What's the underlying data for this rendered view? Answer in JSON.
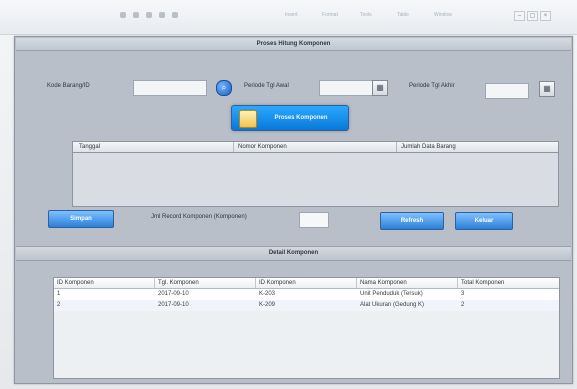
{
  "toolbar": {
    "items": [
      "Insert",
      "Format",
      "Tools",
      "Table",
      "Window"
    ],
    "win_controls": [
      "–",
      "▢",
      "×"
    ]
  },
  "window": {
    "title": "Proses Hitung Komponen",
    "filters": {
      "kode_label": "Kode Barang/ID",
      "kode_value": "",
      "from_label": "Periode Tgl Awal",
      "from_value": "",
      "to_label": "Periode Tgl Akhir",
      "to_value": ""
    },
    "process_button_label": "Proses Komponen",
    "table1": {
      "columns": [
        "Tanggal",
        "Nomor Komponen",
        "Jumlah Data Barang"
      ],
      "rows": []
    },
    "bottom_controls": {
      "left_button_label": "Simpan",
      "info_label": "Jml Record Komponen (Komponen)",
      "info_value": "",
      "right_button1_label": "Refresh",
      "right_button2_label": "Keluar"
    },
    "section2_title": "Detail Komponen",
    "table2": {
      "columns": [
        "ID Komponen",
        "Tgl. Komponen",
        "ID Komponen",
        "Nama Komponen",
        "Total Komponen"
      ],
      "rows": [
        [
          "1",
          "2017-09-10",
          "K-203",
          "Unit Penduduk (Tersuk)",
          "3"
        ],
        [
          "2",
          "2017-09-10",
          "K-209",
          "Alat Ukuran (Gedung K)",
          "2"
        ]
      ]
    }
  },
  "colors": {
    "accent_blue": "#2c7fd7",
    "window_bg": "#b9bfc8",
    "title_bar": "#bfc6cf"
  },
  "icons": {
    "search": "search-icon",
    "calendar": "calendar-icon",
    "process": "document-icon"
  }
}
